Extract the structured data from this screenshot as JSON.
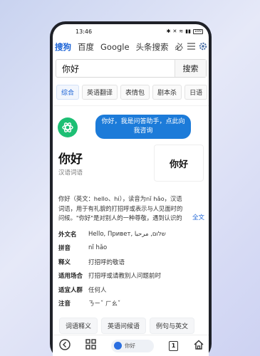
{
  "status_bar": {
    "time": "13:46",
    "battery": "100"
  },
  "engine_tabs": [
    {
      "label": "搜狗",
      "active": true
    },
    {
      "label": "百度"
    },
    {
      "label": "Google"
    },
    {
      "label": "头条搜索"
    },
    {
      "label": "必"
    }
  ],
  "search": {
    "query": "你好",
    "button": "搜索"
  },
  "filters": [
    {
      "label": "综合",
      "active": true
    },
    {
      "label": "英语翻译"
    },
    {
      "label": "表情包"
    },
    {
      "label": "剧本杀"
    },
    {
      "label": "日语"
    }
  ],
  "assistant": {
    "bubble": "你好，我是问答助手，点此向我咨询"
  },
  "word": {
    "title": "你好",
    "subtitle": "汉语词语",
    "char_card": "你好",
    "definition": "你好（英文：hello、hi），读音为nǐ hǎo，汉语词语，用于有礼貌的打招呼或表示与人见面时的问候。\"你好\"是对别人的一种尊敬，遇到认识的人时都可以说。",
    "more": "全文"
  },
  "info": [
    {
      "label": "外文名",
      "value": "Hello, Привет, שלום, مرحبا"
    },
    {
      "label": "拼音",
      "value": "nǐ hǎo"
    },
    {
      "label": "释义",
      "value": "打招呼的敬语"
    },
    {
      "label": "适用场合",
      "value": "打招呼或请教别人问题前时"
    },
    {
      "label": "适宜人群",
      "value": "任何人"
    },
    {
      "label": "注音",
      "value": "ㄋㄧˇ ㄏㄠˇ"
    }
  ],
  "related": [
    "词语释义",
    "英语问候语",
    "例句与英文"
  ],
  "bottom_nav": {
    "pill_text": "你好",
    "tab_count": "1"
  }
}
